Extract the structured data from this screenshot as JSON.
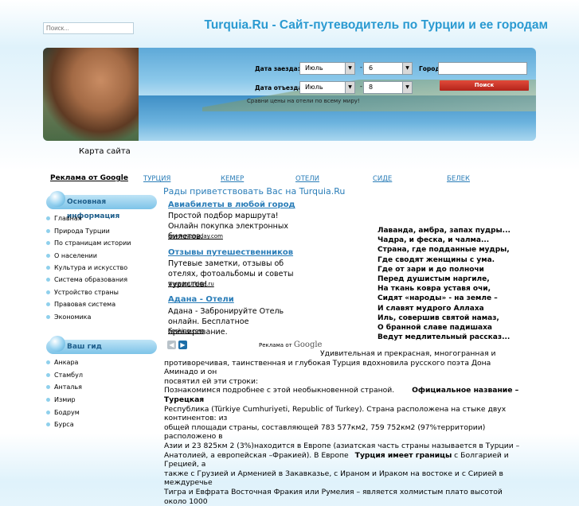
{
  "search": {
    "placeholder": "Поиск..."
  },
  "site_title": "Turquia.Ru - Сайт-путеводитель по Турции и ее городам",
  "booking": {
    "arrival_label": "Дата заезда:",
    "departure_label": "Дата отъезда:",
    "arrival_month": "Июль",
    "arrival_day": "6",
    "departure_month": "Июль",
    "departure_day": "8",
    "city_label": "Город",
    "search_button": "Поиск",
    "compare_text": "Сравни цены на отели по всему миру!"
  },
  "sitemap": "Карта сайта",
  "ads_by_google": "Реклама от Google",
  "top_links": [
    "ТУРЦИЯ",
    "КЕМЕР",
    "ОТЕЛИ",
    "СИДЕ",
    "БЕЛЕК"
  ],
  "welcome": "Рады приветствовать Вас на Turquia.Ru",
  "sidebar": {
    "main_header": "Основная информация",
    "main_items": [
      "Главная",
      "Природа Турции",
      "По страницам истории",
      "О населении",
      "Культура и искусство",
      "Система образования",
      "Устройство страны",
      "Правовая система",
      "Экономика"
    ],
    "guide_header": "Ваш гид",
    "guide_items": [
      "Анкара",
      "Стамбул",
      "Анталья",
      "Измир",
      "Бодрум",
      "Бурса"
    ]
  },
  "ads": [
    {
      "title": "Авиабилеты в любой город",
      "text": "Простой подбор маршрута! Онлайн покупка электронных билетов.",
      "url": "anywayanyday.com"
    },
    {
      "title": "Отзывы путешественников",
      "text": "Путевые заметки, отзывы об отелях, фотоальбомы и советы туристов!",
      "url": "www.tourbina.ru"
    },
    {
      "title": "Адана - Отели",
      "text": "Адана - Забронируйте Отель онлайн. Бесплатное бронирование.",
      "url": "booking.com"
    }
  ],
  "poem": [
    "Лаванда, амбра, запах пудры...",
    "Чадра, и феска, и чалма...",
    "Страна, где подданные мудры,",
    "Где сводят женщины с ума.",
    "Где от зари и до полночи",
    "Перед душистым наргиле,",
    "На ткань ковра уставя очи,",
    "Сидят «народы» - на земле –",
    "И славят мудрого Аллаха",
    "Иль, совершив святой намаз,",
    "О бранной славе падишаха",
    "Ведут медлительный рассказ..."
  ],
  "ads_by_google_2": "Реклама от",
  "google_word": "Google",
  "body_lines": [
    "Удивительная и прекрасная, многогранная и",
    "противоречивая, таинственная и глубокая Турция вдохновила русского поэта Дона Аминадо и он",
    "посвятил ей эти строки:",
    "Познакомимся подробнее с этой необыкновенной страной.",
    "Официальное название  –Турецкая",
    "Республика (Türkiye Cumhuriyeti, Republic of Turkey). Страна расположена на стыке двух континентов: из",
    "общей площади страны, составляющей 783 577км2, 759 752км2 (97%территории) расположено в",
    "Азии и  23  825км  2  (3%)находится в Европе  (азиатская часть страны называется в Турции  –",
    "Анатолией, а европейская –Фракией). В Европе",
    "Турция имеет границы",
    " с Болгарией и Грецией, а",
    "также с Грузией и Арменией в Закавказье, с Ираном и Ираком на востоке и с Сирией в междуречье",
    "Тигра и Евфрата Восточная Фракия или Румелия – является холмистым плато высотой около 1000"
  ]
}
